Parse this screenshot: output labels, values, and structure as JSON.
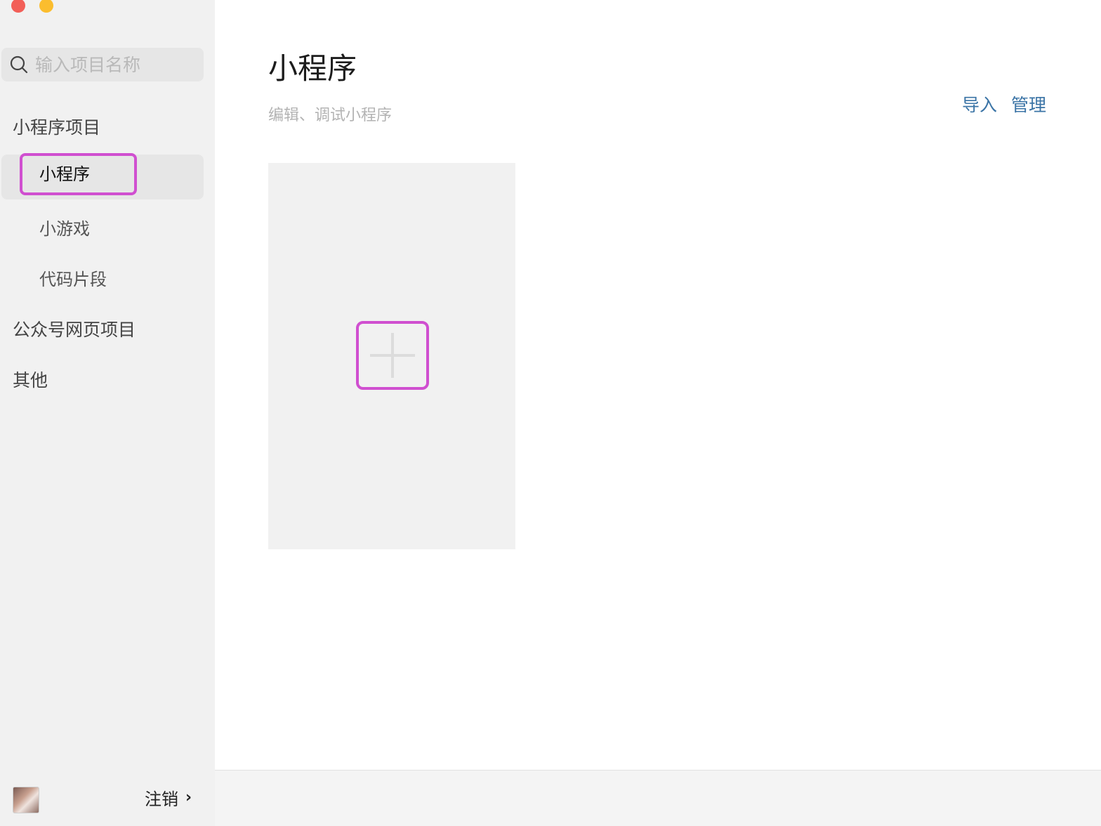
{
  "colors": {
    "close": "#f25f58",
    "minimize": "#fbbd2e",
    "accent_link": "#3b74a6",
    "highlight": "#d04fd0"
  },
  "search": {
    "placeholder": "输入项目名称"
  },
  "sidebar": {
    "groups": {
      "mini_program_projects": "小程序项目",
      "official_account_projects": "公众号网页项目",
      "other": "其他"
    },
    "items": {
      "mini_program": "小程序",
      "mini_game": "小游戏",
      "code_snippet": "代码片段"
    },
    "logout": "注销"
  },
  "main": {
    "title": "小程序",
    "subtitle": "编辑、调试小程序",
    "actions": {
      "import": "导入",
      "manage": "管理"
    }
  }
}
